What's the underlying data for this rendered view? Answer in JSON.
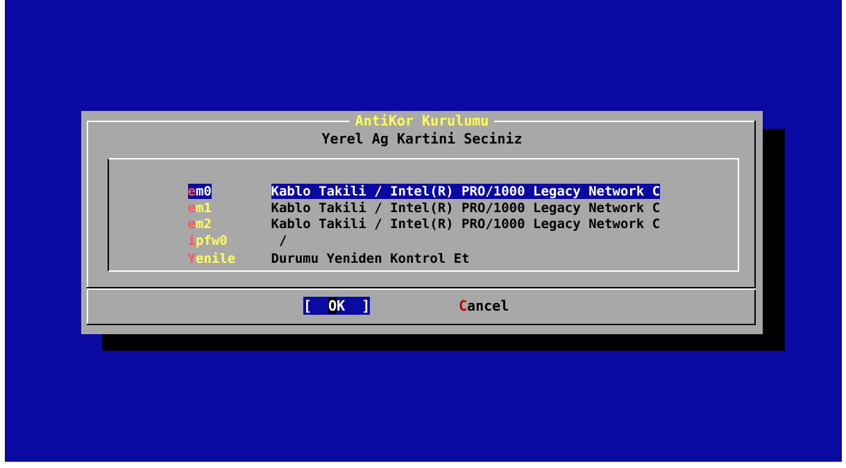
{
  "dialog": {
    "title": "AntiKor Kurulumu",
    "prompt": "Yerel Ag Kartini Seciniz"
  },
  "items": [
    {
      "tag_first": "e",
      "tag_rest": "m0",
      "desc": "Kablo Takili / Intel(R) PRO/1000 Legacy Network C",
      "selected": true
    },
    {
      "tag_first": "e",
      "tag_rest": "m1",
      "desc": "Kablo Takili / Intel(R) PRO/1000 Legacy Network C",
      "selected": false
    },
    {
      "tag_first": "e",
      "tag_rest": "m2",
      "desc": "Kablo Takili / Intel(R) PRO/1000 Legacy Network C",
      "selected": false
    },
    {
      "tag_first": "i",
      "tag_rest": "pfw0",
      "desc": " /",
      "selected": false
    },
    {
      "tag_first": "Y",
      "tag_rest": "enile",
      "desc": "Durumu Yeniden Kontrol Et",
      "selected": false
    }
  ],
  "buttons": {
    "ok": {
      "left": "[  ",
      "hot": "O",
      "rest": "K  ]"
    },
    "cancel": {
      "hot": "C",
      "rest": "ancel"
    }
  },
  "colors": {
    "background": "#0A0AA2",
    "dialog": "#A8A8A8",
    "title": "#FFFF55",
    "hotkey": "#FF5555",
    "selection": "#0A0AA2"
  }
}
